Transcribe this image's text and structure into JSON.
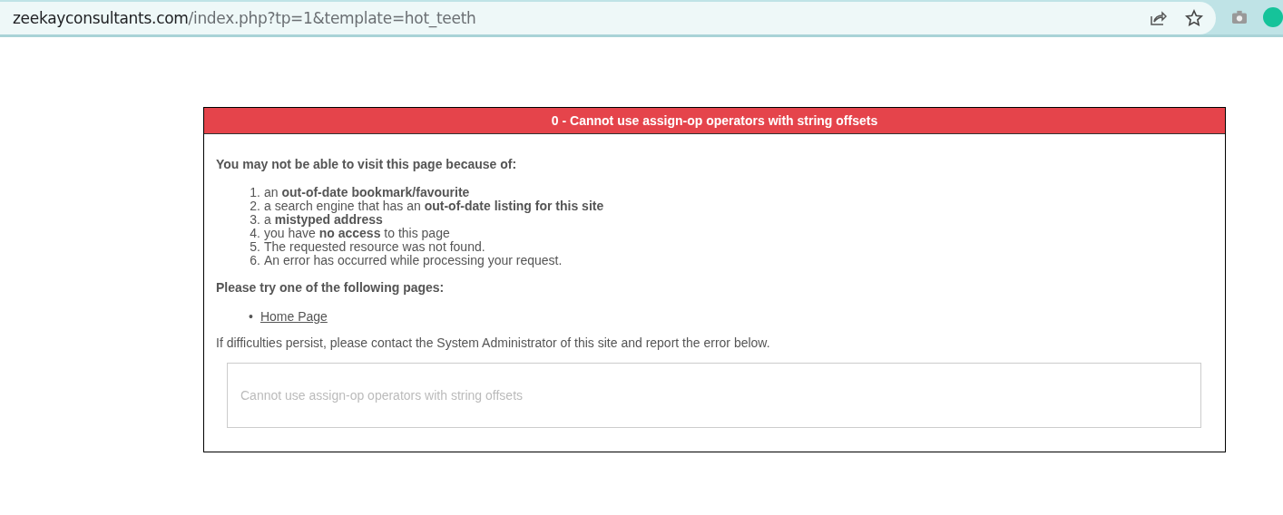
{
  "browser": {
    "url_host": "zeekayconsultants.com",
    "url_path": "/index.php?tp=1&template=hot_teeth"
  },
  "error": {
    "title": "0 - Cannot use assign-op operators with string offsets",
    "intro": "You may not be able to visit this page because of:",
    "reasons": [
      {
        "number": "1.",
        "text": "an **out-of-date bookmark/favourite**"
      },
      {
        "number": "2.",
        "text": "a search engine that has an **out-of-date listing for this site**"
      },
      {
        "number": "3.",
        "text": "a **mistyped address**"
      },
      {
        "number": "4.",
        "text": "you have **no access** to this page"
      },
      {
        "number": "5.",
        "text": "The requested resource was not found."
      },
      {
        "number": "6.",
        "text": "An error has occurred while processing your request."
      }
    ],
    "try_heading": "Please try one of the following pages:",
    "links": [
      {
        "bullet": "•",
        "label": "Home Page"
      }
    ],
    "contact": "If difficulties persist, please contact the System Administrator of this site and report the error below.",
    "message": "Cannot use assign-op operators with string offsets"
  }
}
